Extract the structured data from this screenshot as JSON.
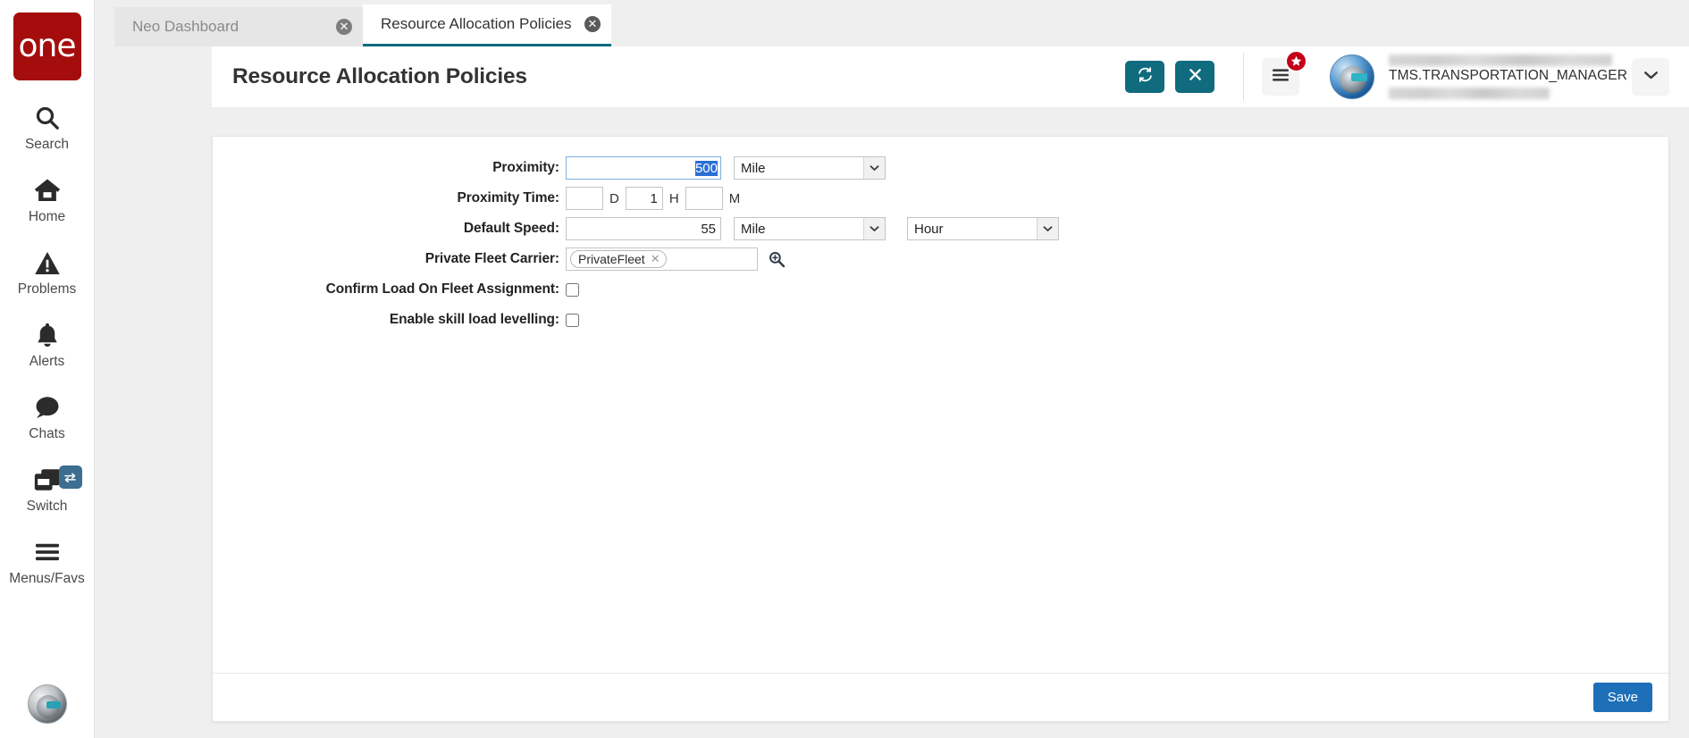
{
  "brand": {
    "logo_text": "one"
  },
  "sidebar": {
    "items": [
      {
        "label": "Search",
        "icon": "search-icon"
      },
      {
        "label": "Home",
        "icon": "home-icon"
      },
      {
        "label": "Problems",
        "icon": "warning-triangle-icon"
      },
      {
        "label": "Alerts",
        "icon": "bell-icon"
      },
      {
        "label": "Chats",
        "icon": "chat-bubble-icon"
      },
      {
        "label": "Switch",
        "icon": "switch-windows-icon",
        "badge_icon": "swap-arrows-icon"
      },
      {
        "label": "Menus/Favs",
        "icon": "hamburger-icon"
      }
    ],
    "avatar_name": "user-avatar"
  },
  "tabs": [
    {
      "label": "Neo Dashboard",
      "active": false,
      "close_icon": "close-circle-icon"
    },
    {
      "label": "Resource Allocation Policies",
      "active": true,
      "close_icon": "close-circle-icon"
    }
  ],
  "header": {
    "title": "Resource Allocation Policies",
    "refresh_icon": "refresh-icon",
    "close_icon": "close-x-icon",
    "menu_icon": "hamburger-menu-icon",
    "menu_badge_icon": "star-icon",
    "user_name": "TMS.TRANSPORTATION_MANAGER",
    "caret_icon": "chevron-down-icon",
    "accent_color": "#0f6b7d",
    "badge_color": "#c20016"
  },
  "form": {
    "proximity": {
      "label": "Proximity:",
      "value": "500",
      "unit": "Mile"
    },
    "proximity_time": {
      "label": "Proximity Time:",
      "days": "",
      "days_unit": "D",
      "hours": "1",
      "hours_unit": "H",
      "minutes": "",
      "minutes_unit": "M"
    },
    "default_speed": {
      "label": "Default Speed:",
      "value": "55",
      "distance_unit": "Mile",
      "time_unit": "Hour"
    },
    "private_fleet_carrier": {
      "label": "Private Fleet Carrier:",
      "token": "PrivateFleet",
      "token_remove_icon": "close-x-icon",
      "picker_icon": "magnifier-plus-icon"
    },
    "confirm_load": {
      "label": "Confirm Load On Fleet Assignment:",
      "checked": false
    },
    "skill_levelling": {
      "label": "Enable skill load levelling:",
      "checked": false
    }
  },
  "footer": {
    "save_label": "Save",
    "save_color": "#1d6fb8"
  }
}
